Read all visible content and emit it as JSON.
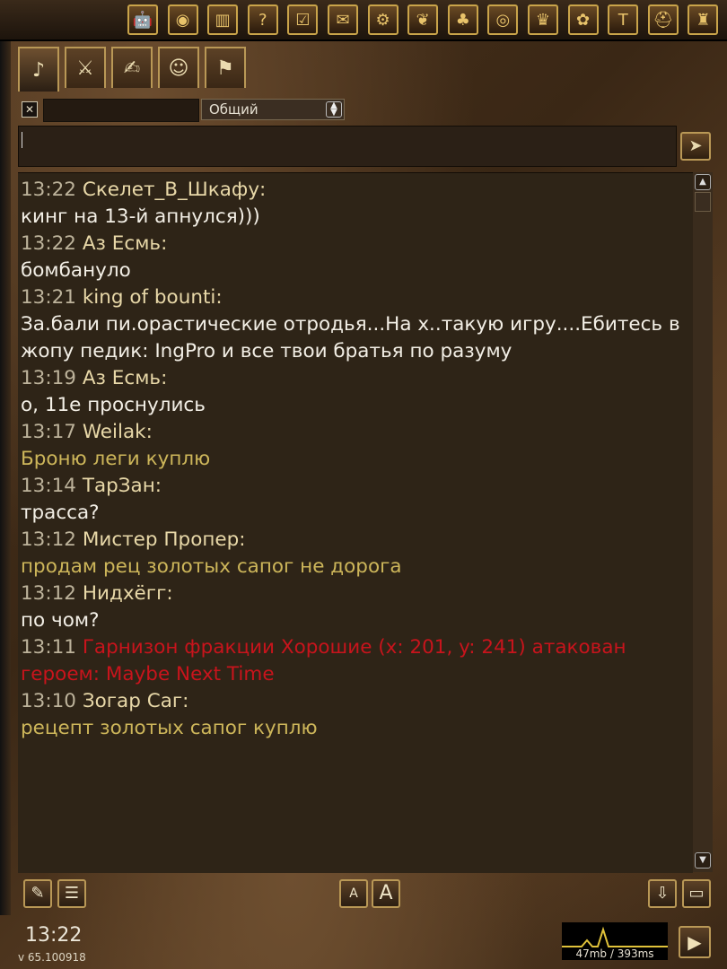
{
  "topbar": {
    "icons": [
      "android-icon",
      "coins-icon",
      "spellbook-icon",
      "quest-icon",
      "checklist-icon",
      "mail-icon",
      "settings-gear-icon",
      "laurel-icon",
      "tree-icon",
      "map-icon",
      "crown-icon",
      "brain-icon",
      "hammer-icon",
      "helmet-icon",
      "castle-icon"
    ]
  },
  "tabs": [
    "horn-icon",
    "swords-icon",
    "writing-icon",
    "masks-icon",
    "weathervane-icon"
  ],
  "chat_header": {
    "close_label": "✕",
    "channel": "Общий"
  },
  "messages": [
    {
      "time": "13:22",
      "author": "Скелет_В_Шкафу:",
      "text": [
        "кинг на 13-й апнулся)))"
      ],
      "style": "white"
    },
    {
      "time": "13:22",
      "author": "Аз Есмь:",
      "text": [
        "бомбануло"
      ],
      "style": "white"
    },
    {
      "time": "13:21",
      "author": "king of bounti:",
      "text": [
        "За.бали пи.орастические отродья...На х..такую игру....Ебитесь в",
        "жопу педик: IngPro и все твои братья по разуму"
      ],
      "style": "white"
    },
    {
      "time": "13:19",
      "author": "Аз Есмь:",
      "text": [
        "о, 11е проснулись"
      ],
      "style": "white"
    },
    {
      "time": "13:17",
      "author": "Weilak:",
      "text": [
        "Броню леги куплю"
      ],
      "style": "gold"
    },
    {
      "time": "13:14",
      "author": "ТарЗан:",
      "text": [
        "трасса?"
      ],
      "style": "white"
    },
    {
      "time": "13:12",
      "author": "Мистер Пропер:",
      "text": [
        "продам рец золотых сапог не дорога"
      ],
      "style": "gold"
    },
    {
      "time": "13:12",
      "author": "Нидхёгг:",
      "text": [
        "по чом?"
      ],
      "style": "white"
    },
    {
      "time": "13:11",
      "author": "",
      "text": [
        "Гарнизон фракции Хорошие (x: 201, y: 241) атакован",
        "героем: Maybe Next Time"
      ],
      "style": "red",
      "system": true
    },
    {
      "time": "13:10",
      "author": "Зогар Саг:",
      "text": [
        "рецепт золотых сапог куплю"
      ],
      "style": "gold"
    }
  ],
  "bottom_toolbar": {
    "font_small": "A",
    "font_large": "A"
  },
  "status": {
    "clock": "13:22",
    "version": "v 65.100918",
    "perf": "47mb / 393ms"
  }
}
